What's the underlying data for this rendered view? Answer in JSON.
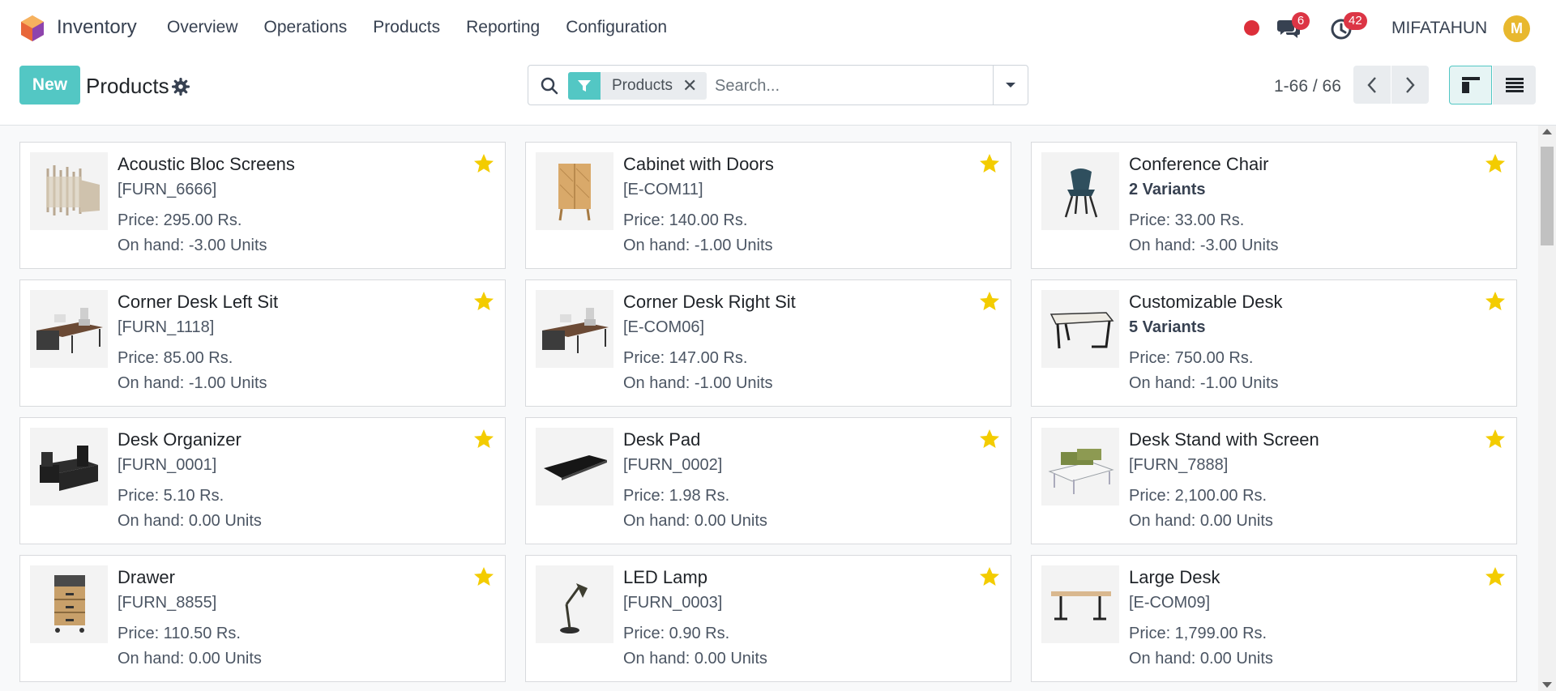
{
  "navbar": {
    "app_name": "Inventory",
    "menu": [
      "Overview",
      "Operations",
      "Products",
      "Reporting",
      "Configuration"
    ],
    "messages_count": "6",
    "activities_count": "42",
    "user_name": "MIFATAHUN",
    "avatar_letter": "M"
  },
  "control_panel": {
    "new_label": "New",
    "title": "Products",
    "facet_label": "Products",
    "search_placeholder": "Search...",
    "pager_value": "1-66 / 66"
  },
  "products": [
    {
      "name": "Acoustic Bloc Screens",
      "sub": "[FURN_6666]",
      "variants": false,
      "price": "Price: 295.00 Rs.",
      "on_hand": "On hand: -3.00 Units",
      "image": "screens"
    },
    {
      "name": "Cabinet with Doors",
      "sub": "[E-COM11]",
      "variants": false,
      "price": "Price: 140.00 Rs.",
      "on_hand": "On hand: -1.00 Units",
      "image": "cabinet"
    },
    {
      "name": "Conference Chair",
      "sub": "2 Variants",
      "variants": true,
      "price": "Price: 33.00 Rs.",
      "on_hand": "On hand: -3.00 Units",
      "image": "chair"
    },
    {
      "name": "Corner Desk Left Sit",
      "sub": "[FURN_1118]",
      "variants": false,
      "price": "Price: 85.00 Rs.",
      "on_hand": "On hand: -1.00 Units",
      "image": "corner-desk"
    },
    {
      "name": "Corner Desk Right Sit",
      "sub": "[E-COM06]",
      "variants": false,
      "price": "Price: 147.00 Rs.",
      "on_hand": "On hand: -1.00 Units",
      "image": "corner-desk"
    },
    {
      "name": "Customizable Desk",
      "sub": "5 Variants",
      "variants": true,
      "price": "Price: 750.00 Rs.",
      "on_hand": "On hand: -1.00 Units",
      "image": "desk"
    },
    {
      "name": "Desk Organizer",
      "sub": "[FURN_0001]",
      "variants": false,
      "price": "Price: 5.10 Rs.",
      "on_hand": "On hand: 0.00 Units",
      "image": "organizer"
    },
    {
      "name": "Desk Pad",
      "sub": "[FURN_0002]",
      "variants": false,
      "price": "Price: 1.98 Rs.",
      "on_hand": "On hand: 0.00 Units",
      "image": "pad"
    },
    {
      "name": "Desk Stand with Screen",
      "sub": "[FURN_7888]",
      "variants": false,
      "price": "Price: 2,100.00 Rs.",
      "on_hand": "On hand: 0.00 Units",
      "image": "stand"
    },
    {
      "name": "Drawer",
      "sub": "[FURN_8855]",
      "variants": false,
      "price": "Price: 110.50 Rs.",
      "on_hand": "On hand: 0.00 Units",
      "image": "drawer"
    },
    {
      "name": "LED Lamp",
      "sub": "[FURN_0003]",
      "variants": false,
      "price": "Price: 0.90 Rs.",
      "on_hand": "On hand: 0.00 Units",
      "image": "lamp"
    },
    {
      "name": "Large Desk",
      "sub": "[E-COM09]",
      "variants": false,
      "price": "Price: 1,799.00 Rs.",
      "on_hand": "On hand: 0.00 Units",
      "image": "large-desk"
    }
  ],
  "colors": {
    "accent": "#53c7c4",
    "star": "#f3cc00",
    "badge": "#dc3545"
  }
}
